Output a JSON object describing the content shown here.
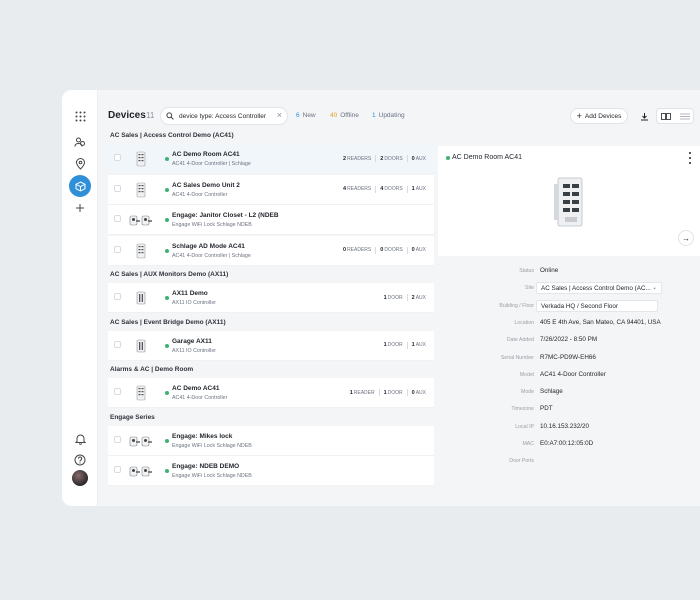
{
  "page": {
    "title": "Devices",
    "count": "11"
  },
  "search": {
    "value": "device type: Access Controller",
    "clear_icon": "close-icon"
  },
  "stats": [
    {
      "count": "6",
      "label": "New",
      "color": "#2f8fd8"
    },
    {
      "count": "40",
      "label": "Offline",
      "color": "#e0a020"
    },
    {
      "count": "1",
      "label": "Updating",
      "color": "#2f8fd8"
    }
  ],
  "toolbar": {
    "add_label": "Add Devices"
  },
  "groups": [
    {
      "label": "AC Sales | Access Control Demo (AC41)",
      "devices": [
        {
          "name": "AC Demo Room AC41",
          "sub": "AC41 4-Door Controller | Schlage",
          "thumb": "controller",
          "counts": [
            [
              "2",
              "READERS"
            ],
            [
              "2",
              "DOORS"
            ],
            [
              "0",
              "AUX"
            ]
          ],
          "selected": true
        },
        {
          "name": "AC Sales Demo Unit 2",
          "sub": "AC41 4-Door Controller",
          "thumb": "controller",
          "counts": [
            [
              "4",
              "READERS"
            ],
            [
              "4",
              "DOORS"
            ],
            [
              "1",
              "AUX"
            ]
          ]
        },
        {
          "name": "Engage: Janitor Closet - L2 (NDEB",
          "sub": "Engage WiFi Lock Schlage NDEB",
          "thumb": "lock",
          "counts": []
        },
        {
          "name": "Schlage AD Mode AC41",
          "sub": "AC41 4-Door Controller | Schlage",
          "thumb": "controller",
          "counts": [
            [
              "0",
              "READERS"
            ],
            [
              "0",
              "DOORS"
            ],
            [
              "0",
              "AUX"
            ]
          ]
        }
      ]
    },
    {
      "label": "AC Sales | AUX Monitors Demo (AX11)",
      "devices": [
        {
          "name": "AX11 Demo",
          "sub": "AX11 IO Controller",
          "thumb": "io",
          "counts": [
            [
              "1",
              "DOOR"
            ],
            [
              "2",
              "AUX"
            ]
          ]
        }
      ]
    },
    {
      "label": "AC Sales | Event Bridge Demo (AX11)",
      "devices": [
        {
          "name": "Garage AX11",
          "sub": "AX11 IO Controller",
          "thumb": "io",
          "counts": [
            [
              "1",
              "DOOR"
            ],
            [
              "1",
              "AUX"
            ]
          ]
        }
      ]
    },
    {
      "label": "Alarms & AC | Demo Room",
      "devices": [
        {
          "name": "AC Demo AC41",
          "sub": "AC41 4-Door Controller",
          "thumb": "controller",
          "counts": [
            [
              "1",
              "READER"
            ],
            [
              "1",
              "DOOR"
            ],
            [
              "0",
              "AUX"
            ]
          ]
        }
      ]
    },
    {
      "label": "Engage Series",
      "devices": [
        {
          "name": "Engage: Mikes lock",
          "sub": "Engage WiFi Lock Schlage NDEB",
          "thumb": "lock",
          "counts": []
        },
        {
          "name": "Engage: NDEB DEMO",
          "sub": "Engage WiFi Lock Schlage NDEB",
          "thumb": "lock",
          "counts": []
        }
      ]
    }
  ],
  "detail": {
    "title": "AC Demo Room AC41",
    "status_color": "#3cb371",
    "properties": [
      {
        "label": "Status",
        "value": "Online",
        "kind": "text"
      },
      {
        "label": "Site",
        "value": "AC Sales | Access Control Demo (AC...",
        "kind": "select"
      },
      {
        "label": "Building / Floor",
        "value": "Verkada HQ / Second Floor",
        "kind": "input"
      },
      {
        "label": "Location",
        "value": "405 E 4th Ave, San Mateo, CA 94401, USA",
        "kind": "text"
      },
      {
        "label": "Date Added",
        "value": "7/26/2022 - 8:50 PM",
        "kind": "text"
      },
      {
        "label": "Serial Number",
        "value": "R7MC-PD9W-EH66",
        "kind": "text"
      },
      {
        "label": "Model",
        "value": "AC41 4-Door Controller",
        "kind": "text"
      },
      {
        "label": "Mode",
        "value": "Schlage",
        "kind": "text"
      },
      {
        "label": "Timezone",
        "value": "PDT",
        "kind": "text"
      },
      {
        "label": "Local IP",
        "value": "10.16.153.232/20",
        "kind": "text"
      },
      {
        "label": "MAC",
        "value": "E0:A7:00:12:05:0D",
        "kind": "text"
      },
      {
        "label": "Door Ports",
        "value": "",
        "kind": "text"
      }
    ]
  },
  "nav": {
    "items": [
      "apps-grid-icon",
      "users-icon",
      "location-pin-icon",
      "devices-icon",
      "add-icon"
    ],
    "bottom": [
      "bell-icon",
      "help-icon",
      "avatar"
    ]
  },
  "colors": {
    "accent": "#2f8fd8",
    "online": "#3cb371",
    "offline": "#e0a020"
  }
}
